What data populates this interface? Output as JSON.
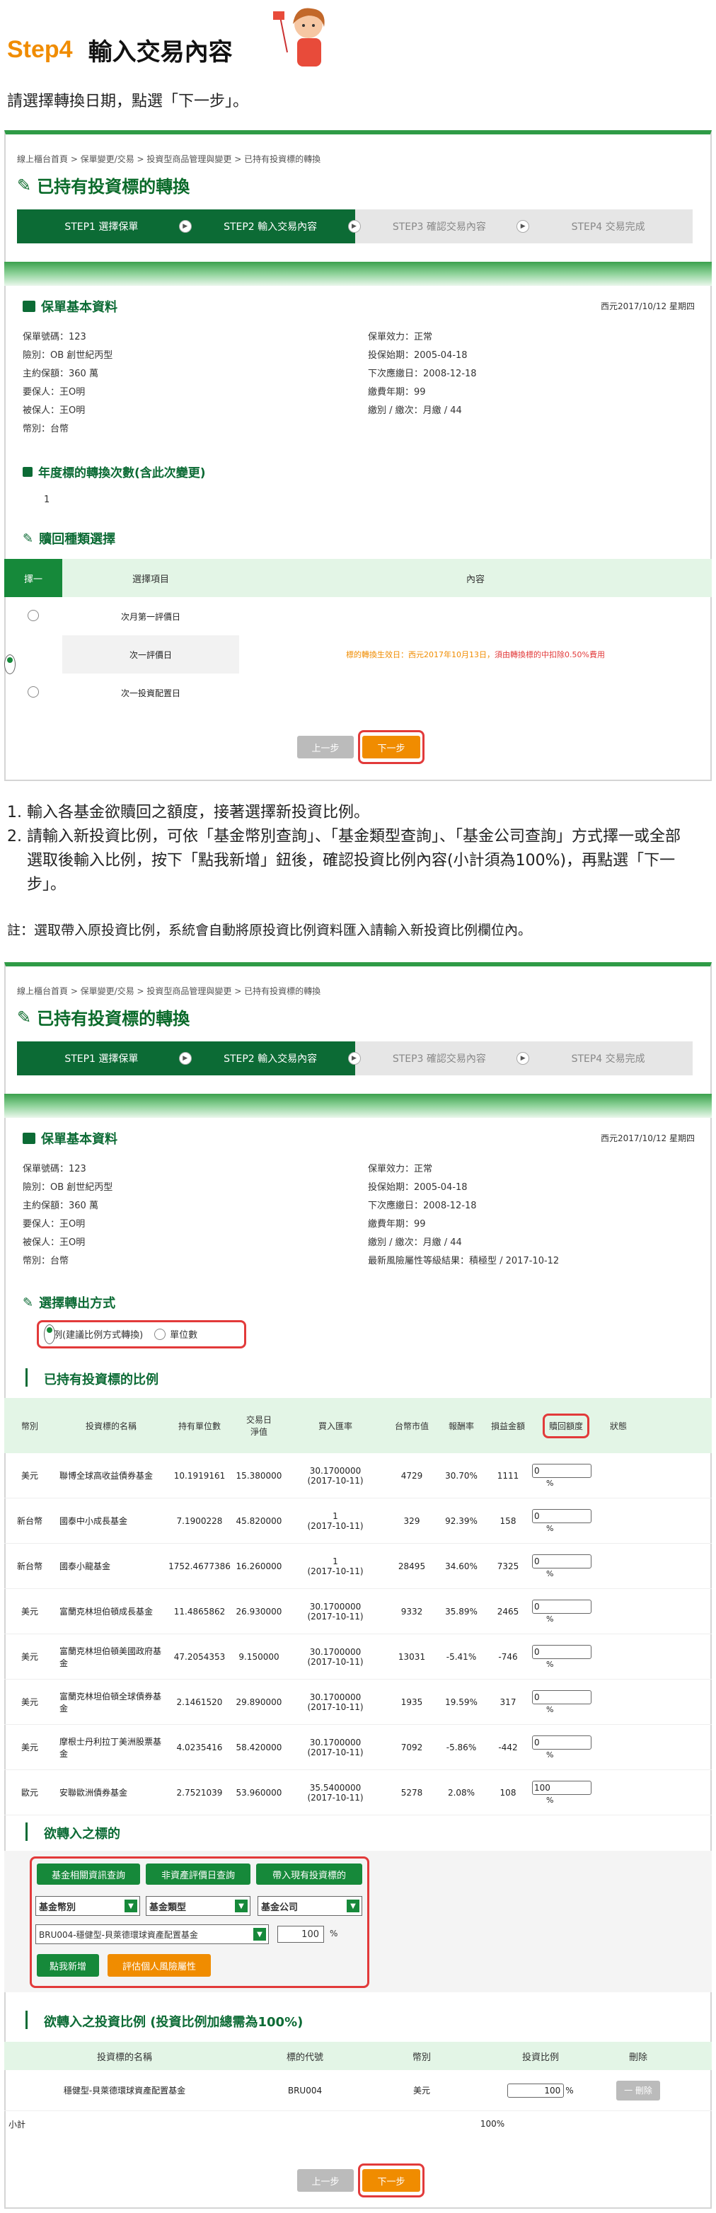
{
  "header": {
    "step": "Step4",
    "title": "輸入交易內容",
    "intro": "請選擇轉換日期，點選「下一步」。"
  },
  "breadcrumb": "線上櫃台首頁 > 保單變更/交易 > 投資型商品管理與變更 > 已持有投資標的轉換",
  "page_title": "已持有投資標的轉換",
  "steps": [
    "STEP1 選擇保單",
    "STEP2 輸入交易內容",
    "STEP3 確認交易內容",
    "STEP4 交易完成"
  ],
  "date": "西元2017/10/12 星期四",
  "basic": {
    "title": "保單基本資料",
    "left": [
      "保單號碼：123",
      "險別：OB 創世紀丙型",
      "主約保額：360 萬",
      "要保人：王O明",
      "被保人：王O明",
      "幣別：台幣"
    ],
    "right": [
      "保單效力：正常",
      "投保始期：2005-04-18",
      "下次應繳日：2008-12-18",
      "繳費年期：99",
      "繳別 / 繳次：月繳 / 44"
    ],
    "right2": [
      "保單效力：正常",
      "投保始期：2005-04-18",
      "下次應繳日：2008-12-18",
      "繳費年期：99",
      "繳別 / 繳次：月繳 / 44",
      "最新風險屬性等級結果：積極型 / 2017-10-12"
    ]
  },
  "annual": {
    "title": "年度標的轉換次數(含此次變更)",
    "value": "1"
  },
  "redeem": {
    "title": "贖回種類選擇",
    "headers": [
      "擇一",
      "選擇項目",
      "內容"
    ],
    "options": [
      "次月第一評價日",
      "次一評價日",
      "次一投資配置日"
    ],
    "note_orange": "標的轉換生效日：西元2017年10月13日，",
    "note_red": "須由轉換標的中扣除0.50%費用"
  },
  "buttons": {
    "prev": "上一步",
    "next": "下一步"
  },
  "instructions": [
    "輸入各基金欲贖回之額度，接著選擇新投資比例。",
    "請輸入新投資比例，可依「基金幣別查詢」、「基金類型查詢」、「基金公司查詢」方式擇一或全部選取後輸入比例，按下「點我新增」鈕後，確認投資比例內容(小計須為100%)，再點選「下一步」。"
  ],
  "note": "註：選取帶入原投資比例，系統會自動將原投資比例資料匯入請輸入新投資比例欄位內。",
  "transfer": {
    "title": "選擇轉出方式",
    "opt1": "比例(建議比例方式轉換)",
    "opt2": "單位數"
  },
  "holdings": {
    "title": "已持有投資標的比例",
    "headers": [
      "幣別",
      "投資標的名稱",
      "持有單位數",
      "交易日\n淨值",
      "買入匯率",
      "台幣市值",
      "報酬率",
      "損益金額",
      "贖回額度",
      "狀態"
    ],
    "rows": [
      [
        "美元",
        "聯博全球高收益債券基金",
        "10.1919161",
        "15.380000",
        "30.1700000\n(2017-10-11)",
        "4729",
        "30.70%",
        "1111",
        "0"
      ],
      [
        "新台幣",
        "國泰中小成長基金",
        "7.1900228",
        "45.820000",
        "1\n(2017-10-11)",
        "329",
        "92.39%",
        "158",
        "0"
      ],
      [
        "新台幣",
        "國泰小龍基金",
        "1752.4677386",
        "16.260000",
        "1\n(2017-10-11)",
        "28495",
        "34.60%",
        "7325",
        "0"
      ],
      [
        "美元",
        "富蘭克林坦伯頓成長基金",
        "11.4865862",
        "26.930000",
        "30.1700000\n(2017-10-11)",
        "9332",
        "35.89%",
        "2465",
        "0"
      ],
      [
        "美元",
        "富蘭克林坦伯頓美國政府基金",
        "47.2054353",
        "9.150000",
        "30.1700000\n(2017-10-11)",
        "13031",
        "-5.41%",
        "-746",
        "0"
      ],
      [
        "美元",
        "富蘭克林坦伯頓全球債券基金",
        "2.1461520",
        "29.890000",
        "30.1700000\n(2017-10-11)",
        "1935",
        "19.59%",
        "317",
        "0"
      ],
      [
        "美元",
        "摩根士丹利拉丁美洲股票基金",
        "4.0235416",
        "58.420000",
        "30.1700000\n(2017-10-11)",
        "7092",
        "-5.86%",
        "-442",
        "0"
      ],
      [
        "歐元",
        "安聯歐洲債券基金",
        "2.7521039",
        "53.960000",
        "35.5400000\n(2017-10-11)",
        "5278",
        "2.08%",
        "108",
        "100"
      ]
    ],
    "pct": "%"
  },
  "target": {
    "title": "欲轉入之標的",
    "btn1": "基金相關資訊查詢",
    "btn2": "非資產評價日查詢",
    "btn3": "帶入現有投資標的",
    "sel1": "基金幣別",
    "sel2": "基金類型",
    "sel3": "基金公司",
    "fund": "BRU004-穩健型-貝萊德環球資產配置基金",
    "ratio": "100",
    "pct": "%",
    "add": "點我新增",
    "risk": "評估個人風險屬性"
  },
  "ratio": {
    "title": "欲轉入之投資比例 (投資比例加總需為100%)",
    "headers": [
      "投資標的名稱",
      "標的代號",
      "幣別",
      "投資比例",
      "刪除"
    ],
    "row": [
      "穩健型-貝萊德環球資產配置基金",
      "BRU004",
      "美元",
      "100",
      "%"
    ],
    "delete": "一 刪除",
    "subtotal": "小計",
    "subtotal_val": "100%"
  }
}
